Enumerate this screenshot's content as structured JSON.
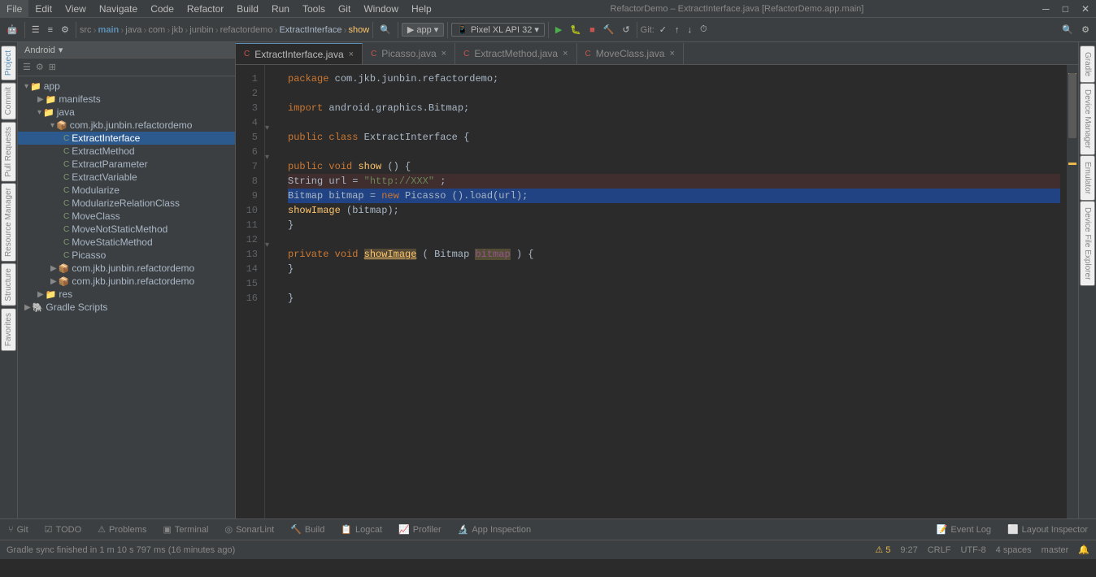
{
  "window": {
    "title": "RefactorDemo – ExtractInterface.java [RefactorDemo.app.main]"
  },
  "menubar": {
    "items": [
      "File",
      "Edit",
      "View",
      "Navigate",
      "Code",
      "Refactor",
      "Build",
      "Run",
      "Tools",
      "Git",
      "Window",
      "Help"
    ]
  },
  "toolbar": {
    "src_label": "src",
    "main_label": "main",
    "java_label": "java",
    "com_label": "com",
    "jkb_label": "jkb",
    "junbin_label": "junbin",
    "refactordemo_label": "refactordemo",
    "extract_interface_label": "ExtractInterface",
    "show_label": "show",
    "app_dropdown": "app",
    "sdk_dropdown": "Pixel XL API 32",
    "git_label": "Git:"
  },
  "project_panel": {
    "title": "Android",
    "items": [
      {
        "id": "app",
        "label": "app",
        "type": "folder",
        "depth": 0,
        "expanded": true
      },
      {
        "id": "manifests",
        "label": "manifests",
        "type": "folder",
        "depth": 1,
        "expanded": false
      },
      {
        "id": "java",
        "label": "java",
        "type": "folder",
        "depth": 1,
        "expanded": true
      },
      {
        "id": "pkg1",
        "label": "com.jkb.junbin.refactordemo",
        "type": "package",
        "depth": 2,
        "expanded": true
      },
      {
        "id": "ExtractInterface",
        "label": "ExtractInterface",
        "type": "class",
        "depth": 3,
        "selected": true
      },
      {
        "id": "ExtractMethod",
        "label": "ExtractMethod",
        "type": "class",
        "depth": 3
      },
      {
        "id": "ExtractParameter",
        "label": "ExtractParameter",
        "type": "class",
        "depth": 3
      },
      {
        "id": "ExtractVariable",
        "label": "ExtractVariable",
        "type": "class",
        "depth": 3
      },
      {
        "id": "Modularize",
        "label": "Modularize",
        "type": "class",
        "depth": 3
      },
      {
        "id": "ModularizeRelationClass",
        "label": "ModularizeRelationClass",
        "type": "class",
        "depth": 3
      },
      {
        "id": "MoveClass",
        "label": "MoveClass",
        "type": "class",
        "depth": 3
      },
      {
        "id": "MoveNotStaticMethod",
        "label": "MoveNotStaticMethod",
        "type": "class",
        "depth": 3
      },
      {
        "id": "MoveStaticMethod",
        "label": "MoveStaticMethod",
        "type": "class",
        "depth": 3
      },
      {
        "id": "Picasso",
        "label": "Picasso",
        "type": "class",
        "depth": 3
      },
      {
        "id": "pkg2",
        "label": "com.jkb.junbin.refactordemo",
        "type": "package",
        "depth": 2
      },
      {
        "id": "pkg3",
        "label": "com.jkb.junbin.refactordemo",
        "type": "package",
        "depth": 2
      },
      {
        "id": "res",
        "label": "res",
        "type": "folder",
        "depth": 1
      },
      {
        "id": "gradle",
        "label": "Gradle Scripts",
        "type": "gradle",
        "depth": 0
      }
    ]
  },
  "editor": {
    "tabs": [
      {
        "label": "ExtractInterface.java",
        "icon": "C",
        "icon_color": "red",
        "active": true
      },
      {
        "label": "Picasso.java",
        "icon": "C",
        "icon_color": "red",
        "active": false
      },
      {
        "label": "ExtractMethod.java",
        "icon": "C",
        "icon_color": "red",
        "active": false
      },
      {
        "label": "MoveClass.java",
        "icon": "C",
        "icon_color": "red",
        "active": false
      }
    ],
    "code_lines": [
      {
        "num": 1,
        "content": "package_line",
        "text": "package com.jkb.junbin.refactordemo;"
      },
      {
        "num": 2,
        "content": "empty"
      },
      {
        "num": 3,
        "content": "import_line",
        "text": "import android.graphics.Bitmap;"
      },
      {
        "num": 4,
        "content": "empty"
      },
      {
        "num": 5,
        "content": "class_decl",
        "text": "public class ExtractInterface {"
      },
      {
        "num": 6,
        "content": "empty"
      },
      {
        "num": 7,
        "content": "method_decl",
        "text": "    public void show() {"
      },
      {
        "num": 8,
        "content": "stmt1",
        "text": "        String url = \"http://XXX\";"
      },
      {
        "num": 9,
        "content": "stmt2",
        "text": "        Bitmap bitmap = new Picasso().load(url);"
      },
      {
        "num": 10,
        "content": "stmt3",
        "text": "        showImage(bitmap);"
      },
      {
        "num": 11,
        "content": "close_brace",
        "text": "    }"
      },
      {
        "num": 12,
        "content": "empty"
      },
      {
        "num": 13,
        "content": "private_method",
        "text": "    private void showImage(Bitmap bitmap) {"
      },
      {
        "num": 14,
        "content": "close_brace2",
        "text": "    }"
      },
      {
        "num": 15,
        "content": "empty"
      },
      {
        "num": 16,
        "content": "close_main",
        "text": "}"
      },
      {
        "num": 17,
        "content": "empty"
      }
    ]
  },
  "bottom_tabs": [
    {
      "label": "Git",
      "icon": "git"
    },
    {
      "label": "TODO",
      "icon": "list"
    },
    {
      "label": "Problems",
      "icon": "warning"
    },
    {
      "label": "Terminal",
      "icon": "terminal"
    },
    {
      "label": "SonarLint",
      "icon": "sonar"
    },
    {
      "label": "Build",
      "icon": "build"
    },
    {
      "label": "Logcat",
      "icon": "logcat"
    },
    {
      "label": "Profiler",
      "icon": "profiler"
    },
    {
      "label": "App Inspection",
      "icon": "inspection"
    },
    {
      "label": "Event Log",
      "icon": "event"
    },
    {
      "label": "Layout Inspector",
      "icon": "layout"
    }
  ],
  "status_bar": {
    "message": "Gradle sync finished in 1 m 10 s 797 ms (16 minutes ago)",
    "position": "9:27",
    "line_ending": "CRLF",
    "encoding": "UTF-8",
    "indent": "4 spaces",
    "branch": "master",
    "warnings_count": "5"
  },
  "right_side_panels": [
    "Gradle",
    "Device Manager",
    "Emulator",
    "Device File Explorer"
  ],
  "left_side_panels": [
    "Project",
    "Commit",
    "Pull Requests",
    "Resource Manager",
    "Structure",
    "Favorites"
  ]
}
